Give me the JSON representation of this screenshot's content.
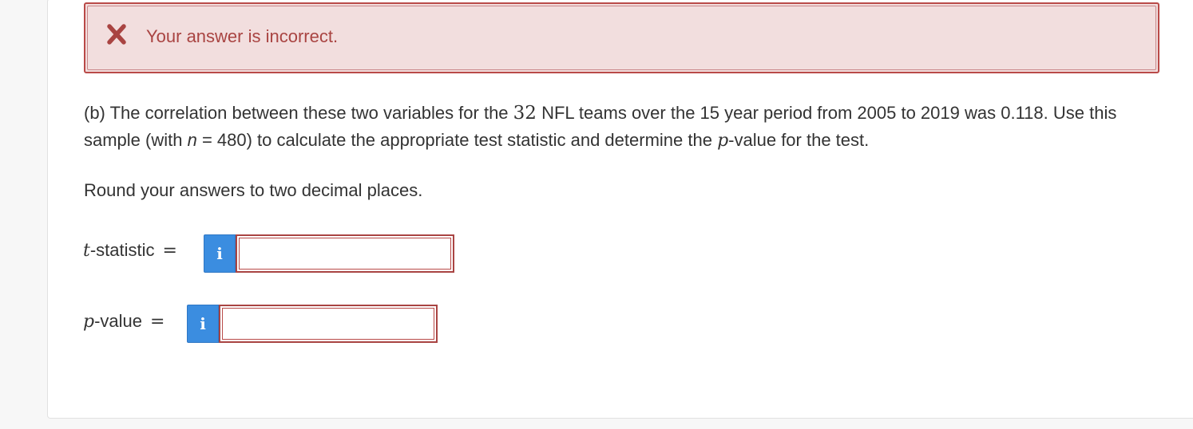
{
  "feedback": {
    "message": "Your answer is incorrect.",
    "icon": "x-mark-icon",
    "color": "#a94442",
    "background": "#f2dede"
  },
  "question": {
    "part1": "(b) The correlation between these two variables for the ",
    "teams": "32",
    "part2": " NFL teams over the 15 year period from 2005 to 2019 was 0.118. Use this sample (with ",
    "n_var": "n",
    "part3": " = 480) to calculate the appropriate test statistic and determine the ",
    "p_var": "p",
    "part4": "-value for the test."
  },
  "instruction": "Round your answers to two decimal places.",
  "fields": {
    "t_stat": {
      "var": "t",
      "label": "-statistic",
      "eq": "=",
      "info": "i",
      "value": ""
    },
    "p_value": {
      "var": "p",
      "label": "-value",
      "eq": "=",
      "info": "i",
      "value": ""
    }
  },
  "accent_color": "#3b8de0"
}
